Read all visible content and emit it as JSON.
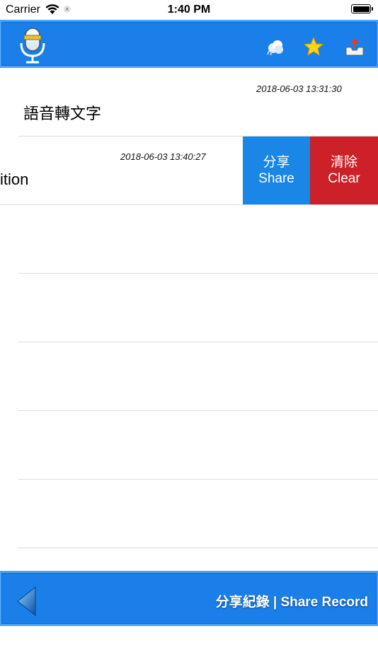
{
  "status_bar": {
    "carrier": "Carrier",
    "time": "1:40 PM"
  },
  "header": {
    "icons": [
      "microphone-icon",
      "weather-icon",
      "star-icon",
      "inbox-upload-icon"
    ],
    "bar_color": "#1a7fe8"
  },
  "records": [
    {
      "date": "2018-06-03 13:31:30",
      "title": "語音轉文字"
    },
    {
      "date": "2018-06-03 13:40:27",
      "title": "ition"
    }
  ],
  "swipe_actions": {
    "share_zh": "分享",
    "share_en": "Share",
    "clear_zh": "清除",
    "clear_en": "Clear",
    "share_color": "#1a86e6",
    "clear_color": "#cc2128"
  },
  "footer": {
    "title": "分享紀錄 | Share Record",
    "back_icon": "back-triangle-icon"
  }
}
